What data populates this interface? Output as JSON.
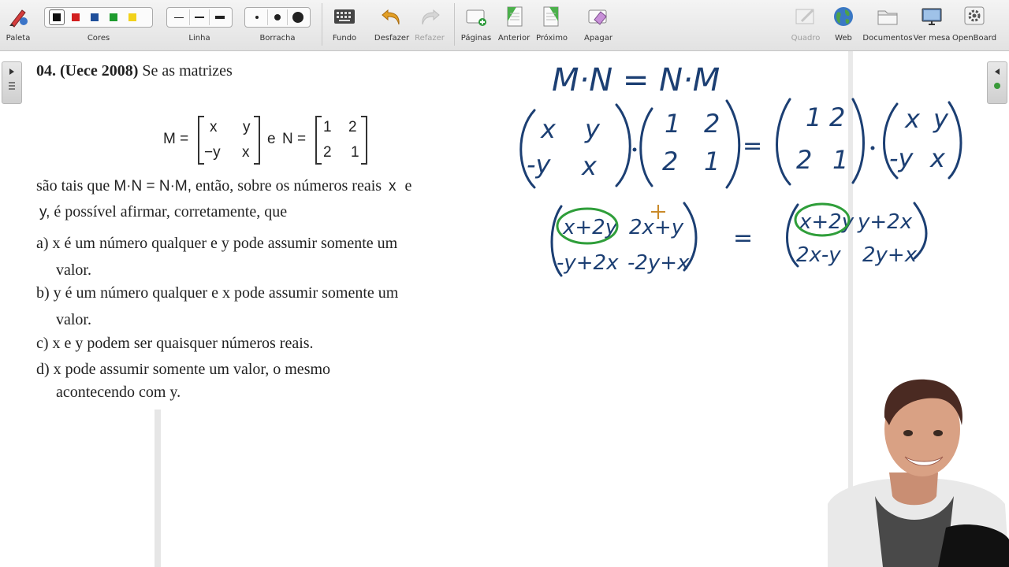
{
  "toolbar": {
    "palette": "Paleta",
    "colors": "Cores",
    "line": "Linha",
    "eraser": "Borracha",
    "background": "Fundo",
    "undo": "Desfazer",
    "redo": "Refazer",
    "pages": "Páginas",
    "previous": "Anterior",
    "next": "Próximo",
    "erase": "Apagar",
    "board": "Quadro",
    "web": "Web",
    "documents": "Documentos",
    "desktop": "Ver mesa",
    "openboard": "OpenBoard",
    "color_values": [
      "#111111",
      "#d21f1f",
      "#1f4f9a",
      "#1e9b2e",
      "#f2d21b"
    ]
  },
  "question": {
    "number": "04. (Uece 2008)",
    "intro": "Se as matrizes",
    "M_label": "M =",
    "M": [
      [
        "x",
        "y"
      ],
      [
        "−y",
        "x"
      ]
    ],
    "and": "e",
    "N_label": "N =",
    "N": [
      [
        "1",
        "2"
      ],
      [
        "2",
        "1"
      ]
    ],
    "stem_1a": "são tais que",
    "stem_1m": "M·N = N·M,",
    "stem_1b": "então, sobre os números reais",
    "stem_1x": "x",
    "stem_1e": "e",
    "stem_2y": "y,",
    "stem_2": "é possível afirmar, corretamente, que",
    "options": {
      "a1": "a)  x  é um número qualquer e  y  pode assumir somente um",
      "a2": "valor.",
      "b1": "b)  y é um número qualquer e  x  pode assumir somente um",
      "b2": "valor.",
      "c1": "c)  x  e  y  podem ser quaisquer números reais.",
      "d1": "d)  x   pode   assumir   somente   um   valor,   o   mesmo",
      "d2": "acontecendo com  y."
    }
  },
  "handwriting": {
    "line1": "M·N = N·M",
    "lhs_a": [
      [
        "x",
        "y"
      ],
      [
        "-y",
        "x"
      ]
    ],
    "lhs_b": [
      [
        "1",
        "2"
      ],
      [
        "2",
        "1"
      ]
    ],
    "rhs_a": [
      [
        "1",
        "2"
      ],
      [
        "2",
        "1"
      ]
    ],
    "rhs_b": [
      [
        "x",
        "y"
      ],
      [
        "-y",
        "x"
      ]
    ],
    "res_left": [
      [
        "x+2y",
        "2x+y"
      ],
      [
        "-y+2x",
        "-2y+x"
      ]
    ],
    "res_right": [
      [
        "x+2y",
        "y+2x"
      ],
      [
        "2x-y",
        "2y+x"
      ]
    ],
    "ink_color": "#1c3f73",
    "highlight_color": "#2f9e3a"
  }
}
